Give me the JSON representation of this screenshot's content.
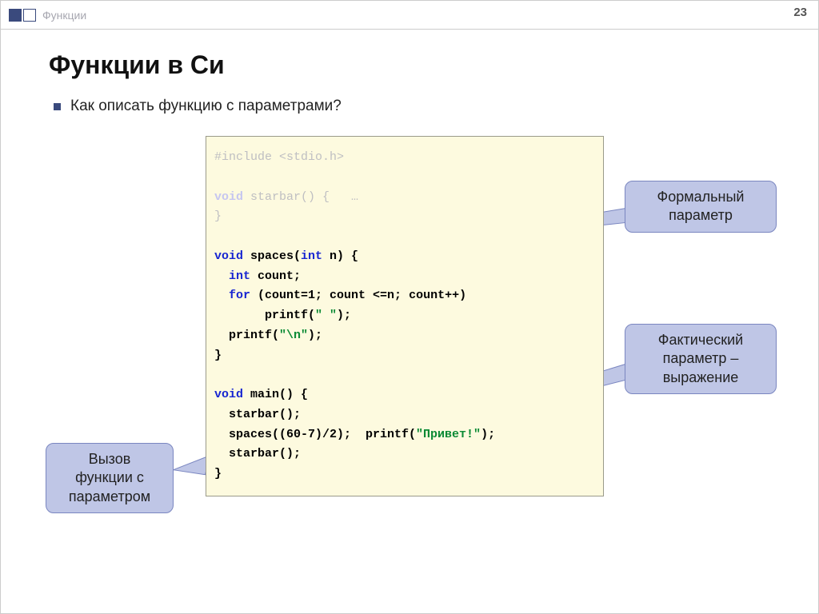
{
  "header": {
    "section_label": "Функции",
    "page_number": "23"
  },
  "title": "Функции в Си",
  "bullet_text": "Как описать функцию с параметрами?",
  "code": {
    "l1_include": "#include <stdio.h>",
    "l3_void": "void",
    "l3_rest": " starbar() {   …",
    "l4": "}",
    "l6_void": "void",
    "l6_name": " spaces(",
    "l6_int": "int",
    "l6_rest": " n) {",
    "l7_int": "int",
    "l7_rest": " count;",
    "l8_for": "for",
    "l8_rest": " (count=1; count <=n; count++)",
    "l9_pre": "       printf(",
    "l9_str": "\" \"",
    "l9_post": ");",
    "l10_pre": "  printf(",
    "l10_str": "\"\\n\"",
    "l10_post": ");",
    "l11": "}",
    "l13_void": "void",
    "l13_rest": " main() {",
    "l14": "  starbar();",
    "l15a": "  spaces((60-7)/2);  printf(",
    "l15_str": "\"Привет!\"",
    "l15b": ");",
    "l16": "  starbar();",
    "l17": "}"
  },
  "callouts": {
    "left": "Вызов функции с параметром",
    "top": "Формальный параметр",
    "right": "Фактический параметр – выражение"
  }
}
